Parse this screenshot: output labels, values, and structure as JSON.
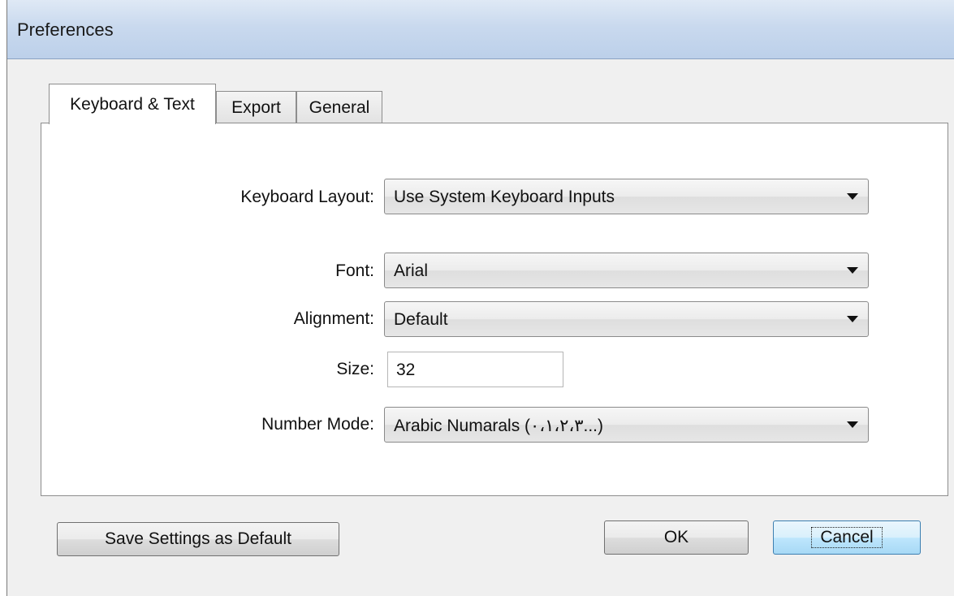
{
  "window": {
    "title": "Preferences"
  },
  "tabs": [
    {
      "label": "Keyboard & Text",
      "active": true
    },
    {
      "label": "Export",
      "active": false
    },
    {
      "label": "General",
      "active": false
    }
  ],
  "form": {
    "keyboard_layout": {
      "label": "Keyboard Layout:",
      "value": "Use System Keyboard Inputs"
    },
    "font": {
      "label": "Font:",
      "value": "Arial"
    },
    "alignment": {
      "label": "Alignment:",
      "value": "Default"
    },
    "size": {
      "label": "Size:",
      "value": "32"
    },
    "number_mode": {
      "label": "Number Mode:",
      "value": "Arabic Numarals (٠،١،٢،٣...)"
    }
  },
  "buttons": {
    "save_default": "Save Settings as Default",
    "ok": "OK",
    "cancel": "Cancel"
  },
  "icons": {
    "dropdown": "chevron-down-icon"
  },
  "colors": {
    "titlebar": "#c9d9ee",
    "window_bg": "#f0f0f0",
    "default_button_border": "#3c7fb1"
  }
}
